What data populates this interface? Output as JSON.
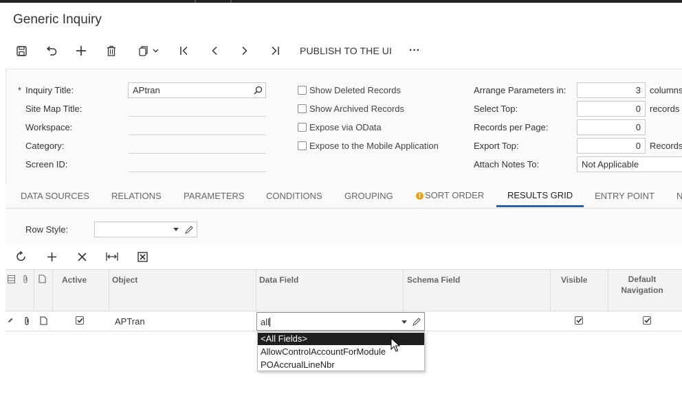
{
  "window": {
    "title": "Generic Inquiry"
  },
  "toolbar": {
    "save_icon": "save-icon",
    "undo_icon": "undo-icon",
    "add_icon": "plus-icon",
    "delete_icon": "trash-icon",
    "copy_icon": "copy-paste-icon",
    "first_icon": "first-record-icon",
    "prev_icon": "previous-icon",
    "next_icon": "next-icon",
    "last_icon": "last-record-icon",
    "publish_label": "PUBLISH TO THE UI",
    "more_label": "···"
  },
  "form": {
    "required_mark": "*",
    "inquiry_title_label": "Inquiry Title:",
    "inquiry_title_value": "APtran",
    "site_map_title_label": "Site Map Title:",
    "workspace_label": "Workspace:",
    "category_label": "Category:",
    "screen_id_label": "Screen ID:",
    "show_deleted_label": "Show Deleted Records",
    "show_archived_label": "Show Archived Records",
    "expose_odata_label": "Expose via OData",
    "expose_mobile_label": "Expose to the Mobile Application",
    "arrange_label": "Arrange Parameters in:",
    "arrange_value": "3",
    "arrange_unit": "columns",
    "select_top_label": "Select Top:",
    "select_top_value": "0",
    "select_top_unit": "records",
    "records_per_page_label": "Records per Page:",
    "records_per_page_value": "0",
    "export_top_label": "Export Top:",
    "export_top_value": "0",
    "export_top_unit": "Records",
    "attach_notes_label": "Attach Notes To:",
    "attach_notes_value": "Not Applicable"
  },
  "tabs": [
    {
      "label": "DATA SOURCES"
    },
    {
      "label": "RELATIONS"
    },
    {
      "label": "PARAMETERS"
    },
    {
      "label": "CONDITIONS"
    },
    {
      "label": "GROUPING"
    },
    {
      "label": "SORT ORDER",
      "warning": true
    },
    {
      "label": "RESULTS GRID",
      "active": true
    },
    {
      "label": "ENTRY POINT"
    },
    {
      "label": "N"
    }
  ],
  "results_grid": {
    "row_style_label": "Row Style:",
    "row_style_value": "",
    "columns": {
      "active": "Active",
      "object": "Object",
      "data_field": "Data Field",
      "schema_field": "Schema Field",
      "visible": "Visible",
      "default_navigation_1": "Default",
      "default_navigation_2": "Navigation"
    },
    "rows": [
      {
        "active": true,
        "object": "APTran",
        "data_field": "all",
        "schema_field": "",
        "visible": true,
        "default_navigation": true
      }
    ],
    "dropdown_options": [
      {
        "label": "<All Fields>",
        "selected": true
      },
      {
        "label": "AllowControlAccountForModule",
        "selected": false
      },
      {
        "label": "POAccrualLineNbr",
        "selected": false
      }
    ]
  },
  "colors": {
    "accent": "#2a5fa5",
    "warning": "#e8a317",
    "selected_option_bg": "#1f1f1f"
  }
}
